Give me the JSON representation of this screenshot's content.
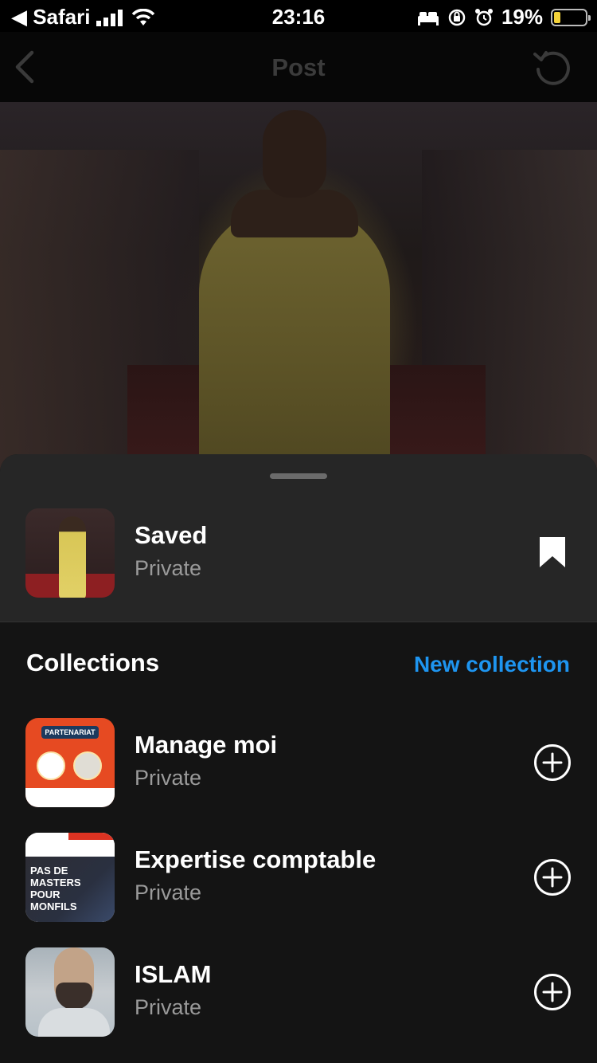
{
  "status_bar": {
    "back_app": "◀ Safari",
    "time": "23:16",
    "battery_percent": "19%"
  },
  "nav": {
    "title": "Post"
  },
  "saved": {
    "title": "Saved",
    "subtitle": "Private"
  },
  "collections": {
    "header": "Collections",
    "new_collection_label": "New collection",
    "items": [
      {
        "title": "Manage moi",
        "subtitle": "Private",
        "thumb_text": "PARTENARIAT"
      },
      {
        "title": "Expertise comptable",
        "subtitle": "Private",
        "thumb_text": "PAS DE MASTERS POUR MONFILS"
      },
      {
        "title": "ISLAM",
        "subtitle": "Private"
      }
    ]
  },
  "icons": {
    "back": "chevron-left-icon",
    "refresh": "refresh-icon",
    "bookmark": "bookmark-filled-icon",
    "add": "plus-circle-icon"
  },
  "colors": {
    "accent": "#1e95f0",
    "sheet_bg": "#141414",
    "sheet_top_bg": "#262626"
  }
}
